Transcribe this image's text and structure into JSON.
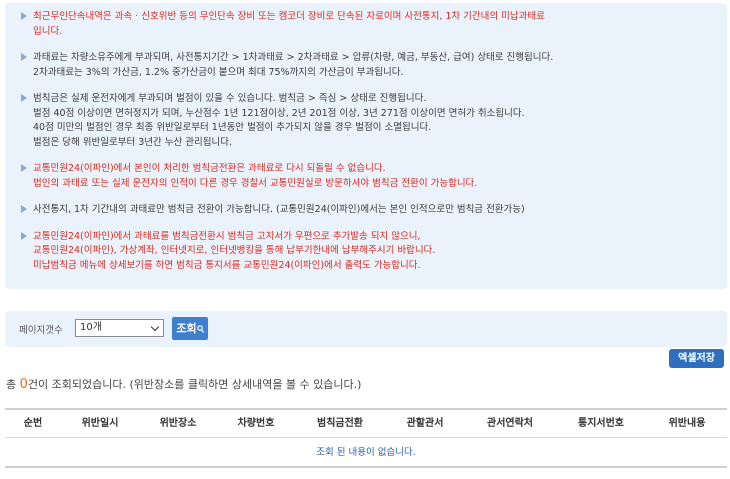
{
  "notice": {
    "items": [
      {
        "color": "red",
        "lines": [
          "최근무인단속내역은 과속 · 신호위반 등의 무인단속 장비 또는 캠코더 장비로 단속된 자료이며 사전통지, 1차 기간내의 미납과태료",
          "입니다."
        ]
      },
      {
        "color": "dark",
        "lines": [
          "과태료는 차량소유주에게 부과되며, 사전통지기간 > 1차과태료 > 2차과태료 > 압류(차량, 예금, 부동산, 급여) 상태로 진행됩니다.",
          "2차과태료는 3%의 가산금, 1.2% 중가산금이 붙으며 최대 75%까지의 가산금이 부과됩니다."
        ]
      },
      {
        "color": "dark",
        "lines": [
          "범칙금은 실제 운전자에게 부과되며 벌점이 있을 수 있습니다. 범칙금 > 즉심 > 상태로 진행됩니다.",
          "벌점 40점 이상이면 면허정지가 되며, 누산점수 1년 121점이상, 2년 201점 이상, 3년 271점 이상이면 면허가 취소됩니다.",
          "40점 미만의 벌점인 경우 최종 위반일로부터 1년동안 벌점이 추가되지 않을 경우 벌점이 소멸됩니다.",
          "벌점은 당해 위반일로부터 3년간 누산 관리됩니다."
        ]
      },
      {
        "color": "red",
        "lines": [
          "교통민원24(이파인)에서 본인이 처리한 범칙금전환은 과태료로 다시 되돌릴 수 없습니다.",
          "법인의 과태료 또는 실제 운전자의 인적이 다른 경우 경찰서 교통민원실로 방문하셔야 범칙금 전환이 가능합니다."
        ]
      },
      {
        "color": "dark",
        "lines": [
          "사전통지, 1차 기간내의 과태료만 범칙금 전환이 가능합니다. (교통민원24(이파인)에서는 본인 인적으로만 범칙금 전환가능)"
        ]
      },
      {
        "color": "red",
        "lines": [
          "교통민원24(이파인)에서 과태료를 범칙금전환시 범칙금 고지서가 우편으로 추가발송 되지 않으니,",
          "교통민원24(이파인), 가상계좌, 인터넷지로, 인터넷뱅킹을 통해 납부기한내에 납부해주시기 바랍니다.",
          "미납범칙금 메뉴에 상세보기를 하면 범칙금 통지서를 교통민원24(이파인)에서 출력도 가능합니다."
        ]
      }
    ]
  },
  "search": {
    "page_size_label": "페이지갯수",
    "page_size_value": "10개",
    "search_button": "조회",
    "search_icon": "search-icon"
  },
  "excel_button": "엑셀저장",
  "result": {
    "prefix": "총",
    "count": "0",
    "suffix": "건이 조회되었습니다. (위반장소를 클릭하면 상세내역을 볼 수 있습니다.)"
  },
  "table": {
    "columns": [
      "순번",
      "위반일시",
      "위반장소",
      "차량번호",
      "범칙금전환",
      "관할관서",
      "관서연락처",
      "통지서번호",
      "위반내용"
    ],
    "empty_message": "조회 된 내용이 없습니다."
  },
  "colors": {
    "notice_bg": "#eaf2fb",
    "red_text": "#e0281e",
    "button_blue": "#3f7fd0",
    "count_orange": "#e8701a"
  }
}
